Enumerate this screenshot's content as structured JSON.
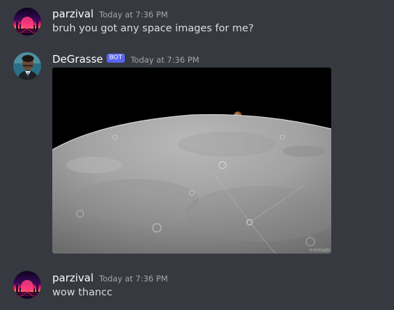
{
  "messages": [
    {
      "username": "parzival",
      "timestamp": "Today at 7:36 PM",
      "text": "bruh you got any space images for me?"
    },
    {
      "username": "DeGrasse",
      "bot_tag": "BOT",
      "timestamp": "Today at 7:36 PM",
      "image_credit": "©VirtSeth"
    },
    {
      "username": "parzival",
      "timestamp": "Today at 7:36 PM",
      "text": "wow thancc"
    }
  ],
  "colors": {
    "background": "#36393f",
    "username": "#ffffff",
    "message_text": "#dcddde",
    "timestamp": "#a3a6aa",
    "bot_tag": "#5865f2"
  }
}
